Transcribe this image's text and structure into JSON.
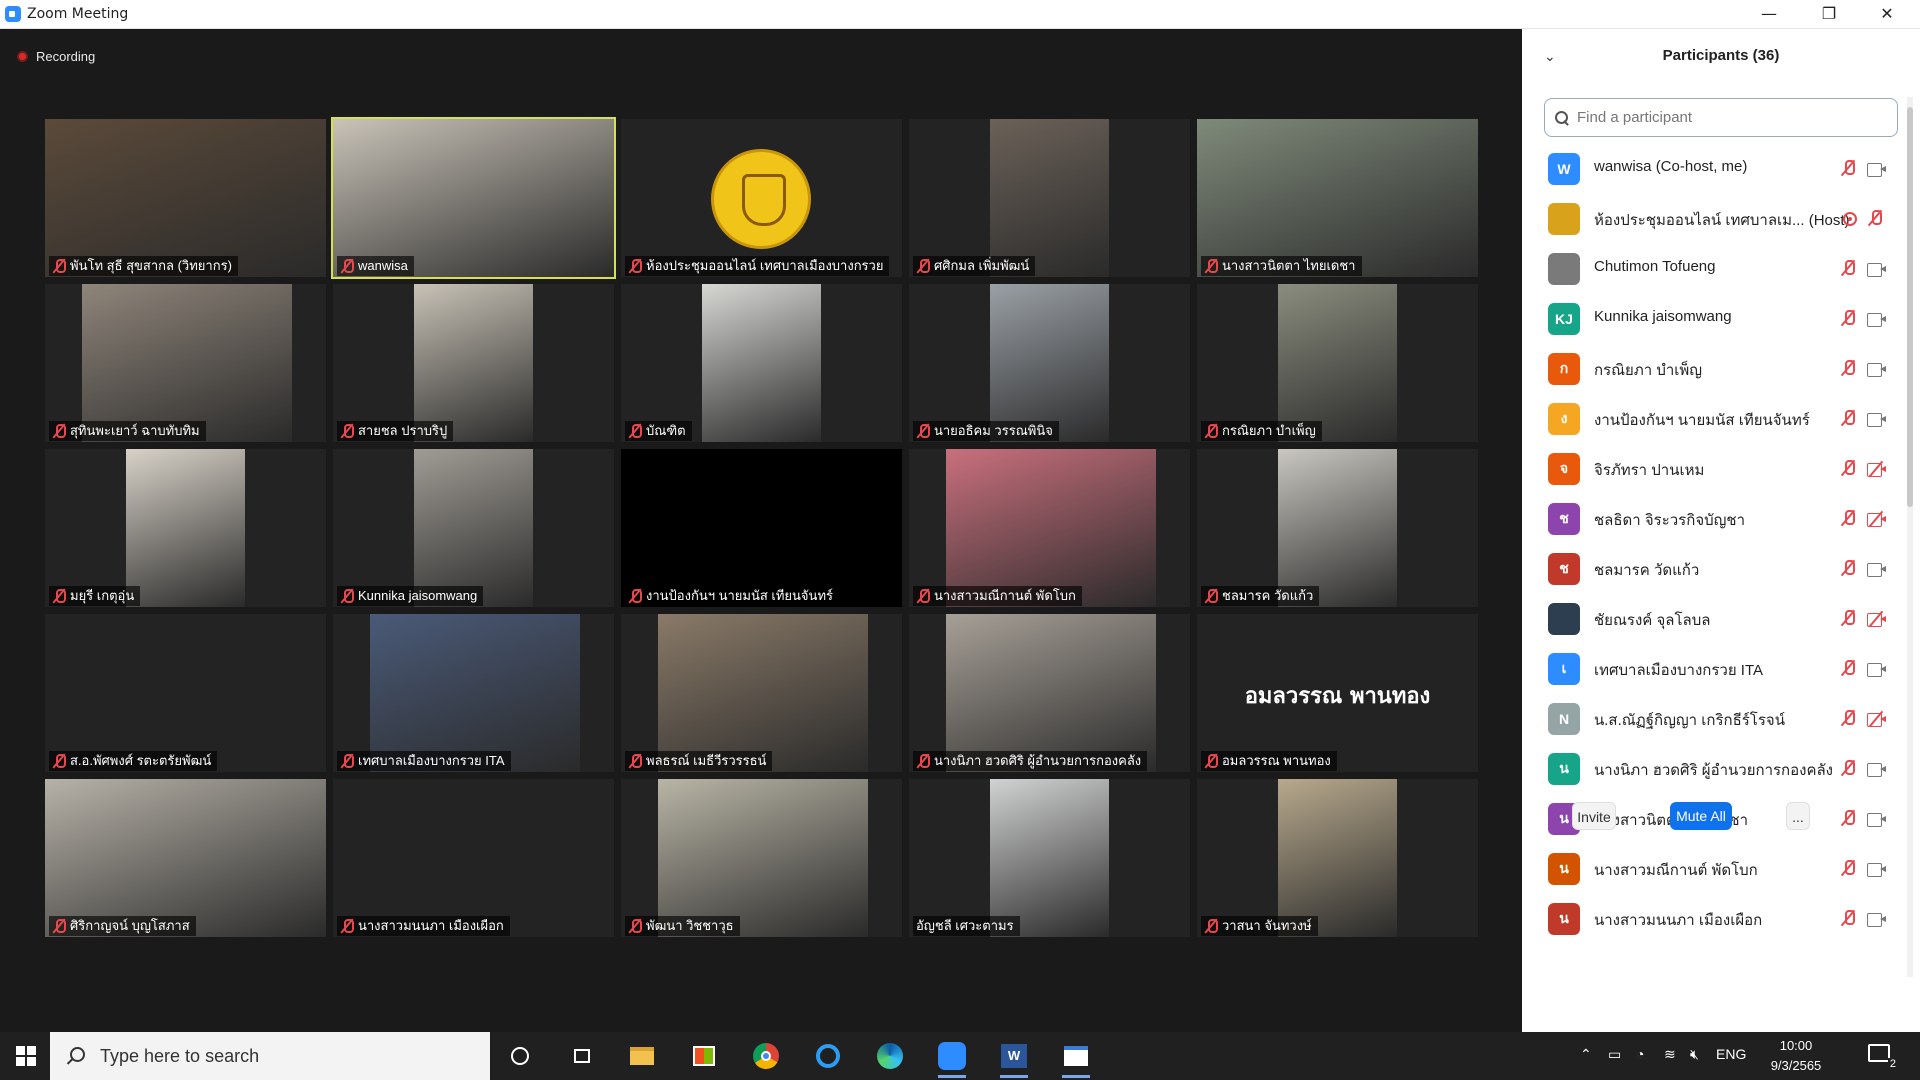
{
  "window": {
    "title": "Zoom Meeting",
    "minimize": "—",
    "restore": "❐",
    "close": "✕"
  },
  "recording": {
    "label": "Recording"
  },
  "tiles": [
    {
      "name": "พันโท สุธี สุขสากล (วิทยากร)",
      "kind": "wide",
      "tone": "#5b4a3a",
      "muted": true
    },
    {
      "name": "wanwisa",
      "kind": "wide",
      "tone": "#c9c3b8",
      "muted": true,
      "active": true
    },
    {
      "name": "ห้องประชุมออนไลน์ เทศบาลเมืองบางกรวย",
      "kind": "logo",
      "muted": true
    },
    {
      "name": "ศศิกมล เพิ่มพัฒน์",
      "kind": "narrow",
      "tone": "#6b6158",
      "muted": true
    },
    {
      "name": "นางสาวนิตตา  ไทยเดชา",
      "kind": "wide",
      "tone": "#7f8a7a",
      "muted": true
    },
    {
      "name": "สุทินพะเยาว์ ฉาบทับทิม",
      "kind": "mid",
      "tone": "#8f857a",
      "muted": true
    },
    {
      "name": "สายชล ปราบริปู",
      "kind": "narrow",
      "tone": "#c8c2b6",
      "muted": true
    },
    {
      "name": "บัณฑิต",
      "kind": "narrow",
      "tone": "#d7d7d4",
      "muted": true
    },
    {
      "name": "นายอธิคม วรรณพินิจ",
      "kind": "narrow",
      "tone": "#9aa0a6",
      "muted": true
    },
    {
      "name": "กรณิยภา บำเพ็ญ",
      "kind": "narrow",
      "tone": "#8a8d7e",
      "muted": true
    },
    {
      "name": "มยุรี เกตุอุ่น",
      "kind": "narrow",
      "tone": "#d8d2c8",
      "muted": true
    },
    {
      "name": "Kunnika jaisomwang",
      "kind": "narrow",
      "tone": "#a09c95",
      "muted": true
    },
    {
      "name": "งานป้องกันฯ นายมนัส  เทียนจันทร์",
      "kind": "black",
      "muted": true
    },
    {
      "name": "นางสาวมณีกานต์ พัดโบก",
      "kind": "mid",
      "tone": "#c9707d",
      "muted": true
    },
    {
      "name": "ชลมารค วัดแก้ว",
      "kind": "narrow",
      "tone": "#c9c7c0",
      "muted": true
    },
    {
      "name": "ส.อ.พัศพงศ์  รตะตรัยพัฒน์",
      "kind": "empty",
      "muted": true
    },
    {
      "name": "เทศบาลเมืองบางกรวย ITA",
      "kind": "mid",
      "tone": "#4a5a78",
      "muted": true
    },
    {
      "name": "พลธรณ์ เมธีวีรวรรธน์",
      "kind": "mid",
      "tone": "#8a7a68",
      "muted": true
    },
    {
      "name": "นางนิภา ฮวดศิริ  ผู้อำนวยการกองคลัง",
      "kind": "mid",
      "tone": "#a7a097",
      "muted": true
    },
    {
      "name": "อมลวรรณ พานทอง",
      "kind": "bigname",
      "muted": true
    },
    {
      "name": "ศิริกาญจน์ บุญโสภาส",
      "kind": "wide",
      "tone": "#b7b2a8",
      "muted": true
    },
    {
      "name": "นางสาวมนนภา เมืองเผือก",
      "kind": "empty",
      "muted": true
    },
    {
      "name": "พัฒนา วิชชาวุธ",
      "kind": "mid",
      "tone": "#b9b5a6",
      "muted": true
    },
    {
      "name": "อัญชลี เศวะตามร",
      "kind": "narrow",
      "tone": "#d1d3d2",
      "muted": false
    },
    {
      "name": "วาสนา จันทวงษ์",
      "kind": "narrow",
      "tone": "#b8a98d",
      "muted": true
    }
  ],
  "tile_big_text": "อมลวรรณ พานทอง",
  "panel": {
    "chevron": "⌄",
    "title": "Participants (36)",
    "search_placeholder": "Find a participant",
    "invite": "Invite",
    "mute_all": "Mute All",
    "more": "...",
    "participants": [
      {
        "initial": "W",
        "color": "#2d8cff",
        "name": "wanwisa (Co-host, me)",
        "cam": "on"
      },
      {
        "initial": "",
        "color": "#d8a21b",
        "name": "ห้องประชุมออนไลน์ เทศบาลเม... (Host)",
        "cam": "rec"
      },
      {
        "initial": "",
        "color": "#7a7a7a",
        "name": "Chutimon Tofueng",
        "cam": "on"
      },
      {
        "initial": "KJ",
        "color": "#17a589",
        "name": "Kunnika jaisomwang",
        "cam": "on"
      },
      {
        "initial": "ก",
        "color": "#e8590c",
        "name": "กรณิยภา บำเพ็ญ",
        "cam": "on"
      },
      {
        "initial": "ง",
        "color": "#f5a623",
        "name": "งานป้องกันฯ นายมนัส  เทียนจันทร์",
        "cam": "on"
      },
      {
        "initial": "จ",
        "color": "#e8590c",
        "name": "จิรภัทรา ปานเหม",
        "cam": "off"
      },
      {
        "initial": "ช",
        "color": "#8e44ad",
        "name": "ชลธิดา จิระวรกิจบัญชา",
        "cam": "off"
      },
      {
        "initial": "ช",
        "color": "#c0392b",
        "name": "ชลมารค วัดแก้ว",
        "cam": "on"
      },
      {
        "initial": "",
        "color": "#2c3e50",
        "name": "ชัยณรงค์ จุลโลบล",
        "cam": "off"
      },
      {
        "initial": "เ",
        "color": "#2d8cff",
        "name": "เทศบาลเมืองบางกรวย ITA",
        "cam": "on"
      },
      {
        "initial": "N",
        "color": "#95a5a6",
        "name": "น.ส.ณัฏฐ์กิญญา เกริกธีร์โรจน์",
        "cam": "off"
      },
      {
        "initial": "น",
        "color": "#17a589",
        "name": "นางนิภา ฮวดศิริ  ผู้อำนวยการกองคลัง",
        "cam": "on"
      },
      {
        "initial": "น",
        "color": "#8e44ad",
        "name": "นางสาวนิตตา  ไทยเดชา",
        "cam": "on"
      },
      {
        "initial": "น",
        "color": "#d35400",
        "name": "นางสาวมณีกานต์ พัดโบก",
        "cam": "on"
      },
      {
        "initial": "น",
        "color": "#c0392b",
        "name": "นางสาวมนนภา เมืองเผือก",
        "cam": "on"
      }
    ]
  },
  "taskbar": {
    "search_placeholder": "Type here to search",
    "lang": "ENG",
    "time": "10:00",
    "date": "9/3/2565",
    "notif_count": "2"
  }
}
